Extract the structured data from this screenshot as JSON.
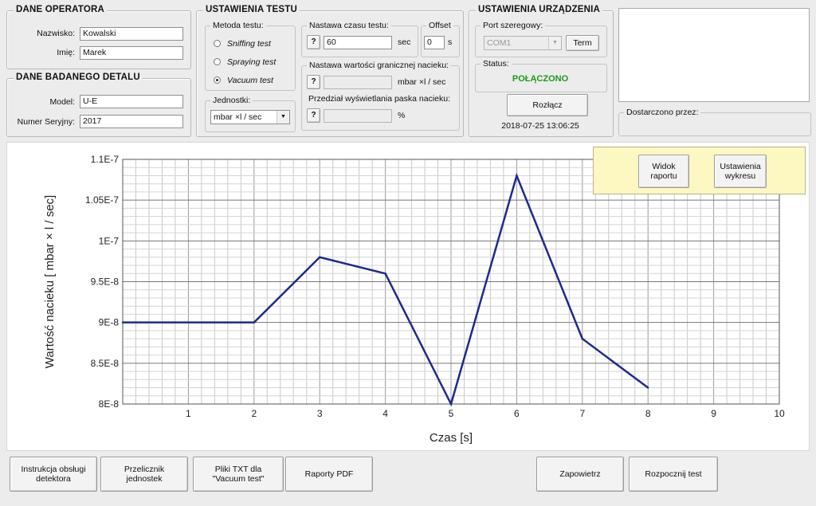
{
  "operator": {
    "title": "DANE OPERATORA",
    "surname_label": "Nazwisko:",
    "surname_value": "Kowalski",
    "name_label": "Imię:",
    "name_value": "Marek"
  },
  "detail": {
    "title": "DANE BADANEGO DETALU",
    "model_label": "Model:",
    "model_value": "U-E",
    "serial_label": "Numer Seryjny:",
    "serial_value": "2017"
  },
  "test_settings": {
    "title": "USTAWIENIA TESTU",
    "method_title": "Metoda testu:",
    "methods": [
      "Sniffing test",
      "Spraying test",
      "Vacuum test"
    ],
    "selected_method": "Vacuum test",
    "units_title": "Jednostki:",
    "units_value": "mbar ×l / sec",
    "time_title": "Nastawa czasu testu:",
    "help_label": "?",
    "time_value": "60",
    "time_unit": "sec",
    "offset_title": "Offset",
    "offset_value": "0",
    "offset_unit": "s",
    "limit_title": "Nastawa wartości granicznej nacieku:",
    "limit_value": "",
    "limit_unit": "mbar ×l / sec",
    "bar_title": "Przedział wyświetlania paska nacieku:",
    "bar_value": "",
    "bar_unit": "%"
  },
  "device": {
    "title": "USTAWIENIA URZĄDZENIA",
    "port_title": "Port szeregowy:",
    "port_value": "COM1",
    "term_label": "Term",
    "status_title": "Status:",
    "status_value": "POŁĄCZONO",
    "status_color": "#1a9a1a",
    "disconnect_label": "Rozłącz",
    "datetime": "2018-07-25 13:06:25"
  },
  "supplier": {
    "label": "Dostarczono przez:"
  },
  "chart_buttons": {
    "report_view": "Widok raportu",
    "chart_settings": "Ustawienia wykresu"
  },
  "chart_data": {
    "type": "line",
    "x": [
      0,
      2,
      3,
      4,
      5,
      6,
      7,
      8
    ],
    "values": [
      9e-08,
      9e-08,
      9.8e-08,
      9.6e-08,
      8e-08,
      1.08e-07,
      8.8e-08,
      8.2e-08
    ],
    "xlabel": "Czas [s]",
    "ylabel": "Wartość nacieku  [ mbar × l / sec]",
    "xlim": [
      0,
      10
    ],
    "ylim": [
      8e-08,
      1.1e-07
    ],
    "xticks": [
      "1",
      "2",
      "3",
      "4",
      "5",
      "6",
      "7",
      "8",
      "9",
      "10"
    ],
    "yticks": [
      "8E-8",
      "8.5E-8",
      "9E-8",
      "9.5E-8",
      "1E-7",
      "1.05E-7",
      "1.1E-7"
    ],
    "line_color": "#1f2a8a",
    "grid": true
  },
  "bottom_buttons": {
    "instructions": "Instrukcja obsługi detektora",
    "converter": "Przelicznik jednostek",
    "txt_files": "Pliki TXT dla \"Vacuum test\"",
    "pdf_reports": "Raporty PDF",
    "vent": "Zapowietrz",
    "start": "Rozpocznij test"
  }
}
